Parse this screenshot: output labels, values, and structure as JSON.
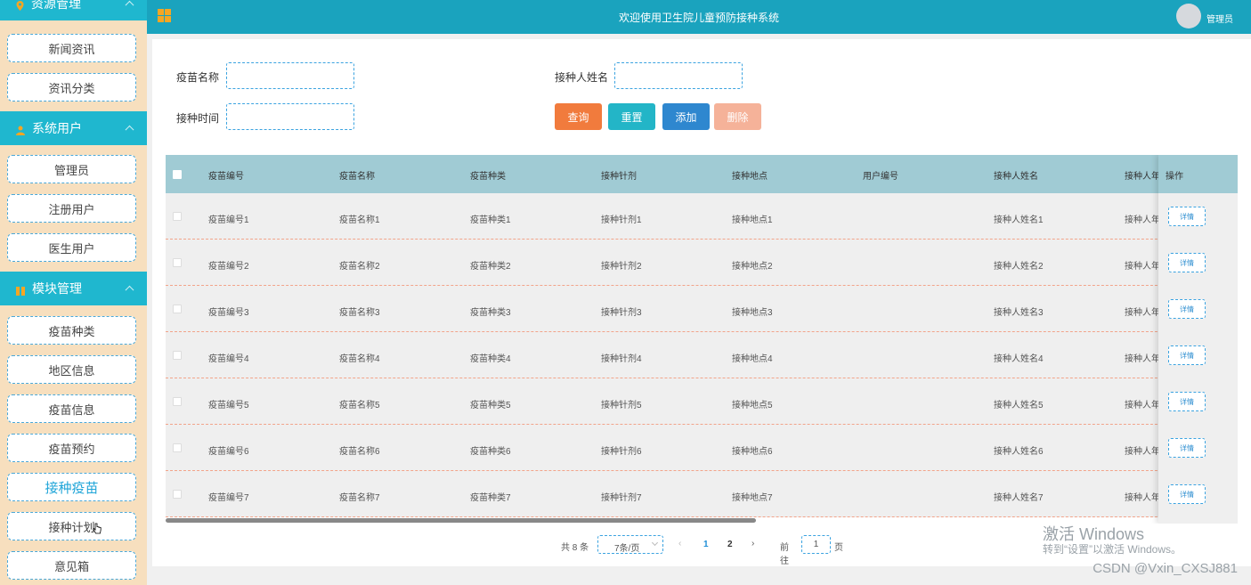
{
  "sidebar": {
    "sections": [
      {
        "title": "资源管理",
        "icon": "pin-icon",
        "items": [
          "新闻资讯",
          "资讯分类"
        ]
      },
      {
        "title": "系统用户",
        "icon": "user-icon",
        "items": [
          "管理员",
          "注册用户",
          "医生用户"
        ]
      },
      {
        "title": "模块管理",
        "icon": "module-icon",
        "items": [
          "疫苗种类",
          "地区信息",
          "疫苗信息",
          "疫苗预约",
          "接种疫苗",
          "接种计划",
          "意见箱"
        ]
      }
    ],
    "active_item": "接种疫苗"
  },
  "header": {
    "title": "欢迎使用卫生院儿童预防接种系统",
    "user": "管理员"
  },
  "filters": {
    "vaccine_name_label": "疫苗名称",
    "receiver_name_label": "接种人姓名",
    "time_label": "接种时间",
    "search": "查询",
    "reset": "重置",
    "add": "添加",
    "delete": "删除"
  },
  "table": {
    "columns": [
      "疫苗编号",
      "疫苗名称",
      "疫苗种类",
      "接种针剂",
      "接种地点",
      "用户编号",
      "接种人姓名",
      "接种人年"
    ],
    "ops_label": "操作",
    "detail_label": "详情",
    "rows": [
      [
        "疫苗编号1",
        "疫苗名称1",
        "疫苗种类1",
        "接种针剂1",
        "接种地点1",
        "",
        "接种人姓名1",
        "接种人年"
      ],
      [
        "疫苗编号2",
        "疫苗名称2",
        "疫苗种类2",
        "接种针剂2",
        "接种地点2",
        "",
        "接种人姓名2",
        "接种人年"
      ],
      [
        "疫苗编号3",
        "疫苗名称3",
        "疫苗种类3",
        "接种针剂3",
        "接种地点3",
        "",
        "接种人姓名3",
        "接种人年"
      ],
      [
        "疫苗编号4",
        "疫苗名称4",
        "疫苗种类4",
        "接种针剂4",
        "接种地点4",
        "",
        "接种人姓名4",
        "接种人年"
      ],
      [
        "疫苗编号5",
        "疫苗名称5",
        "疫苗种类5",
        "接种针剂5",
        "接种地点5",
        "",
        "接种人姓名5",
        "接种人年"
      ],
      [
        "疫苗编号6",
        "疫苗名称6",
        "疫苗种类6",
        "接种针剂6",
        "接种地点6",
        "",
        "接种人姓名6",
        "接种人年"
      ],
      [
        "疫苗编号7",
        "疫苗名称7",
        "疫苗种类7",
        "接种针剂7",
        "接种地点7",
        "",
        "接种人姓名7",
        "接种人年"
      ]
    ]
  },
  "pagination": {
    "total": "共 8 条",
    "page_size": "7条/页",
    "page1": "1",
    "page2": "2",
    "goto": "前往",
    "goto_value": "1",
    "page_word": "页"
  },
  "watermark": {
    "activate_title": "激活 Windows",
    "activate_sub": "转到“设置”以激活 Windows。",
    "csdn": "CSDN @Vxin_CXSJ881"
  },
  "colors": {
    "sidebar_bg": "#f7dfbe",
    "header_teal": "#1fb7cf",
    "topbar": "#1aa3be",
    "search_btn": "#f17b3d",
    "reset_btn": "#23b5c7",
    "add_btn": "#2e87cf",
    "delete_btn": "#f5b299",
    "table_head": "#a0cbd4"
  }
}
